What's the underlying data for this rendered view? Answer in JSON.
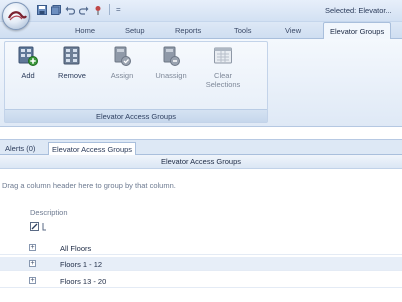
{
  "quick_access": {
    "items": [
      "save-icon",
      "save-all-icon",
      "undo-icon",
      "redo-icon",
      "pin-icon"
    ],
    "more_glyph": "="
  },
  "window": {
    "title": "Selected: Elevator..."
  },
  "tabs": [
    {
      "label": "Home",
      "active": false
    },
    {
      "label": "Setup",
      "active": false
    },
    {
      "label": "Reports",
      "active": false
    },
    {
      "label": "Tools",
      "active": false
    },
    {
      "label": "View",
      "active": false
    },
    {
      "label": "Elevator Groups",
      "active": true
    }
  ],
  "ribbon": {
    "buttons": [
      {
        "label": "Add",
        "enabled": true,
        "icon": "add-icon"
      },
      {
        "label": "Remove",
        "enabled": true,
        "icon": "remove-icon"
      },
      {
        "label": "Assign",
        "enabled": false,
        "icon": "assign-icon"
      },
      {
        "label": "Unassign",
        "enabled": false,
        "icon": "unassign-icon"
      },
      {
        "label": "Clear Selections",
        "enabled": false,
        "icon": "clear-selections-icon"
      }
    ],
    "group_caption": "Elevator Access Groups"
  },
  "document_tabs": [
    {
      "label": "Alerts (0)",
      "active": false
    },
    {
      "label": "Elevator Access Groups",
      "active": true
    }
  ],
  "panel": {
    "title": "Elevator Access Groups",
    "grouping_hint": "Drag a column header here to group by that column.",
    "column_header": "Description",
    "rows": [
      {
        "label": "All Floors",
        "expander": "+"
      },
      {
        "label": "Floors 1 - 12",
        "expander": "+"
      },
      {
        "label": "Floors 13 - 20",
        "expander": "+"
      }
    ]
  },
  "colors": {
    "accent": "#3b6db0",
    "row_alternate": "#e7eef8",
    "ribbon_bg": "#e6eef8",
    "disabled_text": "#7d8797"
  }
}
